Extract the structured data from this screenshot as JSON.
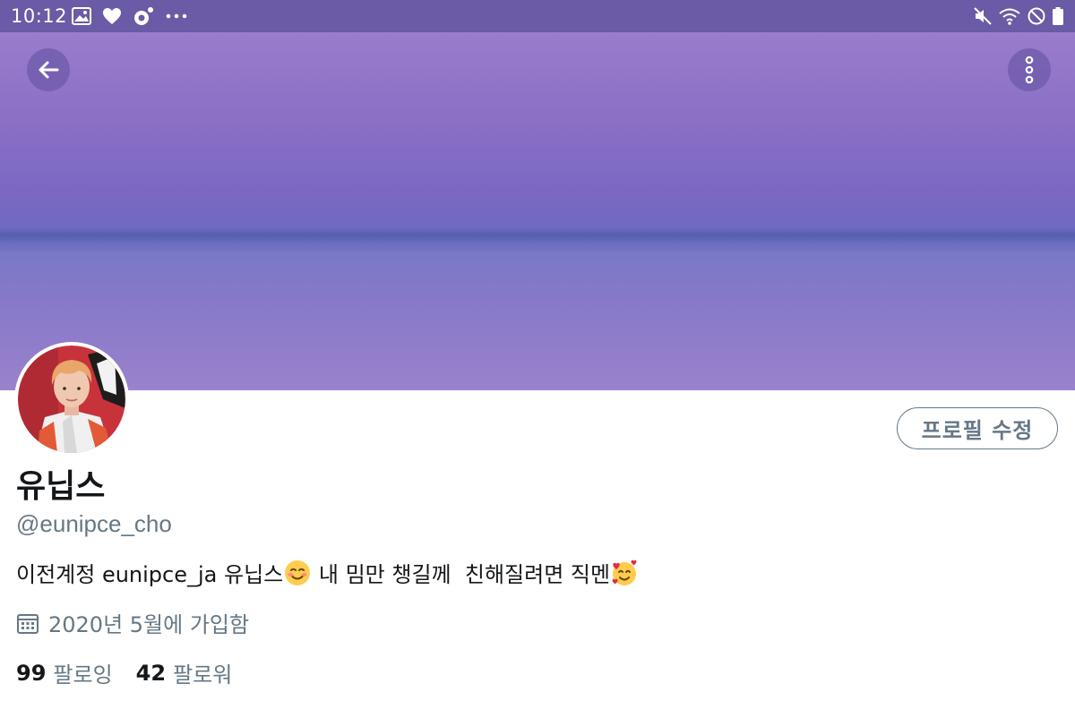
{
  "status_bar": {
    "time": "10:12",
    "left_icons": [
      "image-icon",
      "heart-icon",
      "app-icon",
      "more-dots-icon"
    ],
    "right_icons": [
      "mute-icon",
      "wifi-icon",
      "dnd-icon",
      "battery-icon"
    ]
  },
  "header": {
    "back_icon": "arrow-left-icon",
    "more_icon": "more-vertical-icon"
  },
  "profile": {
    "edit_label": "프로필 수정",
    "display_name": "유닙스",
    "handle": "@eunipce_cho",
    "bio_part1": "이전계정 eunipce_ja 유닙스",
    "bio_part2": " 내 밈만 챙길께  친해질려면 직멘",
    "joined": "2020년 5월에 가입함",
    "following_count": "99",
    "following_label": "팔로잉",
    "followers_count": "42",
    "followers_label": "팔로워"
  },
  "colors": {
    "status_bar": "#6b5aa5",
    "secondary_text": "#657786",
    "primary_text": "#14171a"
  }
}
